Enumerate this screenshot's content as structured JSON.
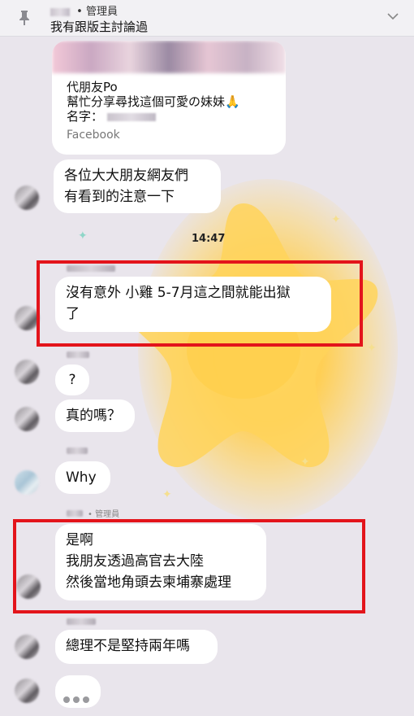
{
  "pinned": {
    "sender_role": "管理員",
    "text": "我有跟版主討論過"
  },
  "fb_card": {
    "line1": "代朋友Po",
    "line2": "幫忙分享尋找這個可愛の妹妹🙏",
    "line3": "名字：",
    "source": "Facebook"
  },
  "messages": [
    {
      "text_lines": [
        "各位大大朋友網友們",
        "有看到的注意一下"
      ]
    },
    {
      "time": "14:47"
    },
    {
      "text_lines": [
        "沒有意外 小雞 5-7月這之間就能出獄",
        "了"
      ]
    },
    {
      "text": "?"
    },
    {
      "text": "真的嗎？"
    },
    {
      "text": "Why"
    },
    {
      "sender_role": "管理員",
      "text_lines": [
        "是啊",
        "我朋友透過高官去大陸",
        "然後當地角頭去柬埔寨處理"
      ]
    },
    {
      "text": "總理不是堅持兩年嗎"
    }
  ],
  "colors": {
    "highlight": "#e3141b",
    "bubble": "#ffffff",
    "background": "#e9e5ec"
  },
  "icons": [
    "pin-icon",
    "chevron-down-icon",
    "typing-indicator"
  ]
}
